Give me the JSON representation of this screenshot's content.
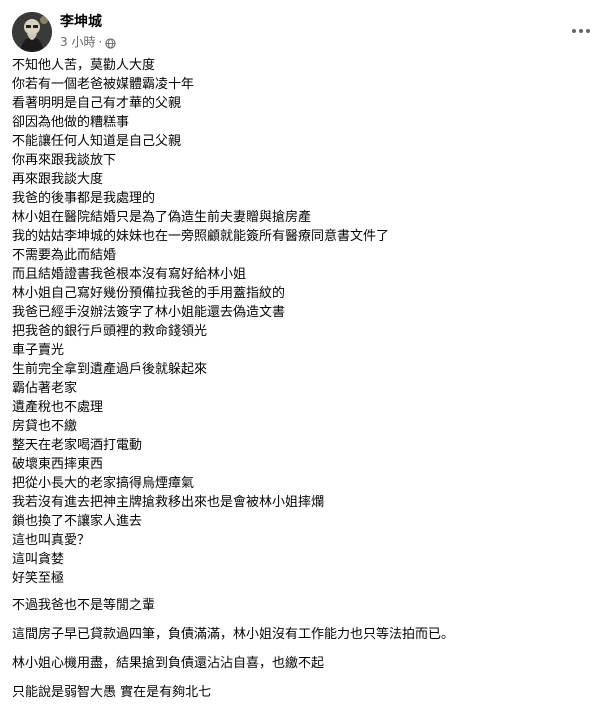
{
  "header": {
    "author": "李坤城",
    "time": "3 小時",
    "separator": "·",
    "more_icon": "more-horizontal-icon",
    "privacy_icon": "globe-icon"
  },
  "body_lines": [
    "不知他人苦，莫勸人大度",
    "你若有一個老爸被媒體霸凌十年",
    "看著明明是自己有才華的父親",
    "卻因為他做的糟糕事",
    "不能讓任何人知道是自己父親",
    "你再來跟我談放下",
    "再來跟我談大度",
    "我爸的後事都是我處理的",
    "林小姐在醫院結婚只是為了偽造生前夫妻贈與搶房產",
    "我的姑姑李坤城的妹妹也在一旁照顧就能簽所有醫療同意書文件了",
    "不需要為此而結婚",
    "而且結婚證書我爸根本沒有寫好給林小姐",
    "林小姐自己寫好幾份預備拉我爸的手用蓋指紋的",
    "我爸已經手沒辦法簽字了林小姐能還去偽造文書",
    "把我爸的銀行戶頭裡的救命錢領光",
    "車子賣光",
    "生前完全拿到遺產過戶後就躲起來",
    "霸佔著老家",
    "遺產稅也不處理",
    "房貸也不繳",
    "整天在老家喝酒打電動",
    "破壞東西摔東西",
    "把從小長大的老家搞得烏煙瘴氣",
    "我若沒有進去把神主牌搶救移出來也是會被林小姐摔爛",
    "鎖也換了不讓家人進去",
    "這也叫真愛？",
    "這叫貪婪",
    "好笑至極"
  ],
  "tail_lines": [
    "不過我爸也不是等閒之輩",
    "這間房子早已貸款過四筆，負債滿滿，林小姐沒有工作能力也只等法拍而已。",
    "林小姐心機用盡，結果搶到負債還沾沾自喜，也繳不起",
    "只能說是弱智大愚 實在是有夠北七"
  ]
}
